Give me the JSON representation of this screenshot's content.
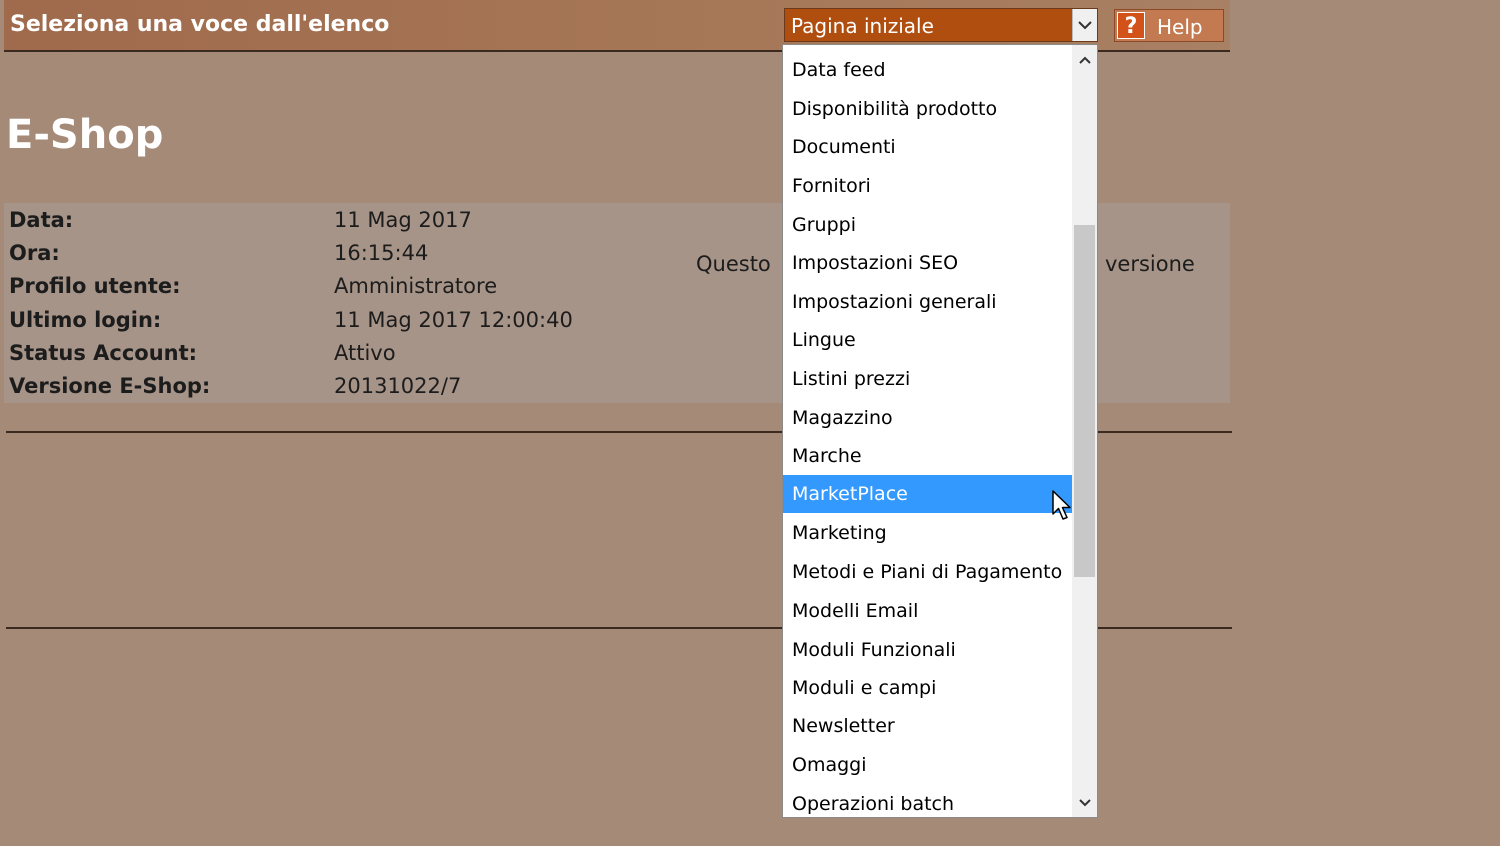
{
  "topbar": {
    "title": "Seleziona una voce dall'elenco",
    "select_value": "Pagina iniziale",
    "help_label": "Help",
    "help_icon": "?"
  },
  "page": {
    "title": "E-Shop"
  },
  "info": [
    {
      "key": "Data:",
      "value": "11 Mag 2017"
    },
    {
      "key": "Ora:",
      "value": "16:15:44"
    },
    {
      "key": "Profilo utente:",
      "value": "Amministratore"
    },
    {
      "key": "Ultimo login:",
      "value": "11 Mag 2017 12:00:40"
    },
    {
      "key": "Status Account:",
      "value": "Attivo"
    },
    {
      "key": "Versione E-Shop:",
      "value": "20131022/7"
    }
  ],
  "side_text": {
    "left": "Questo",
    "right": "versione"
  },
  "dropdown": {
    "options": [
      "Data feed",
      "Disponibilità prodotto",
      "Documenti",
      "Fornitori",
      "Gruppi",
      "Impostazioni SEO",
      "Impostazioni generali",
      "Lingue",
      "Listini prezzi",
      "Magazzino",
      "Marche",
      "MarketPlace",
      "Marketing",
      "Metodi e Piani di Pagamento",
      "Modelli Email",
      "Moduli Funzionali",
      "Moduli e campi",
      "Newsletter",
      "Omaggi",
      "Operazioni batch"
    ],
    "highlighted": "MarketPlace"
  },
  "colors": {
    "background": "#a68a78",
    "select_bg": "#b04e10",
    "highlight": "#3399ff"
  },
  "icons": [
    "chevron-down-icon",
    "question-icon",
    "scroll-up-icon",
    "scroll-down-icon",
    "mouse-pointer-icon"
  ]
}
